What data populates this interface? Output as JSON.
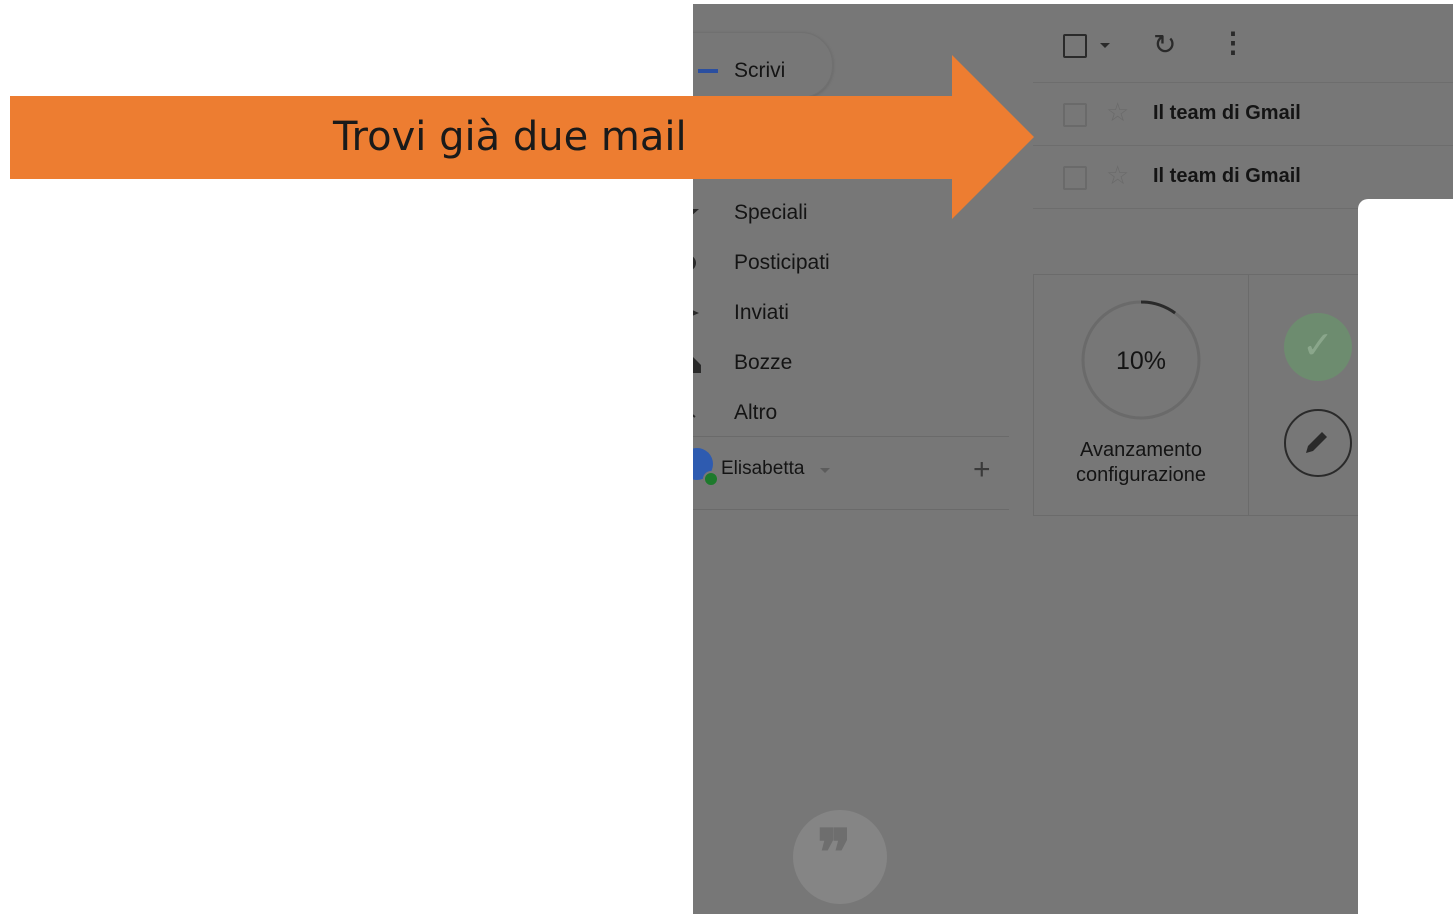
{
  "callout": {
    "text": "Trovi già due mail"
  },
  "sidebar": {
    "compose_label": "Scrivi",
    "items": [
      {
        "label": "Speciali",
        "icon": "star-icon"
      },
      {
        "label": "Posticipati",
        "icon": "clock-icon"
      },
      {
        "label": "Inviati",
        "icon": "send-icon"
      },
      {
        "label": "Bozze",
        "icon": "draft-icon"
      },
      {
        "label": "Altro",
        "icon": "chevron-down-icon"
      }
    ],
    "account_name": "Elisabetta",
    "add_label": "+"
  },
  "toolbar": {
    "refresh_icon": "↻",
    "more_icon": "⋮"
  },
  "mails": [
    {
      "sender": "Il team di Gmail",
      "unread": true
    },
    {
      "sender": "Il team di Gmail",
      "unread": true
    }
  ],
  "setup": {
    "progress": 0.1,
    "progress_label": "10%",
    "caption_line1": "Avanzamento",
    "caption_line2": "configurazione"
  },
  "colors": {
    "callout": "#ed7d31",
    "overlay": "#777777"
  }
}
